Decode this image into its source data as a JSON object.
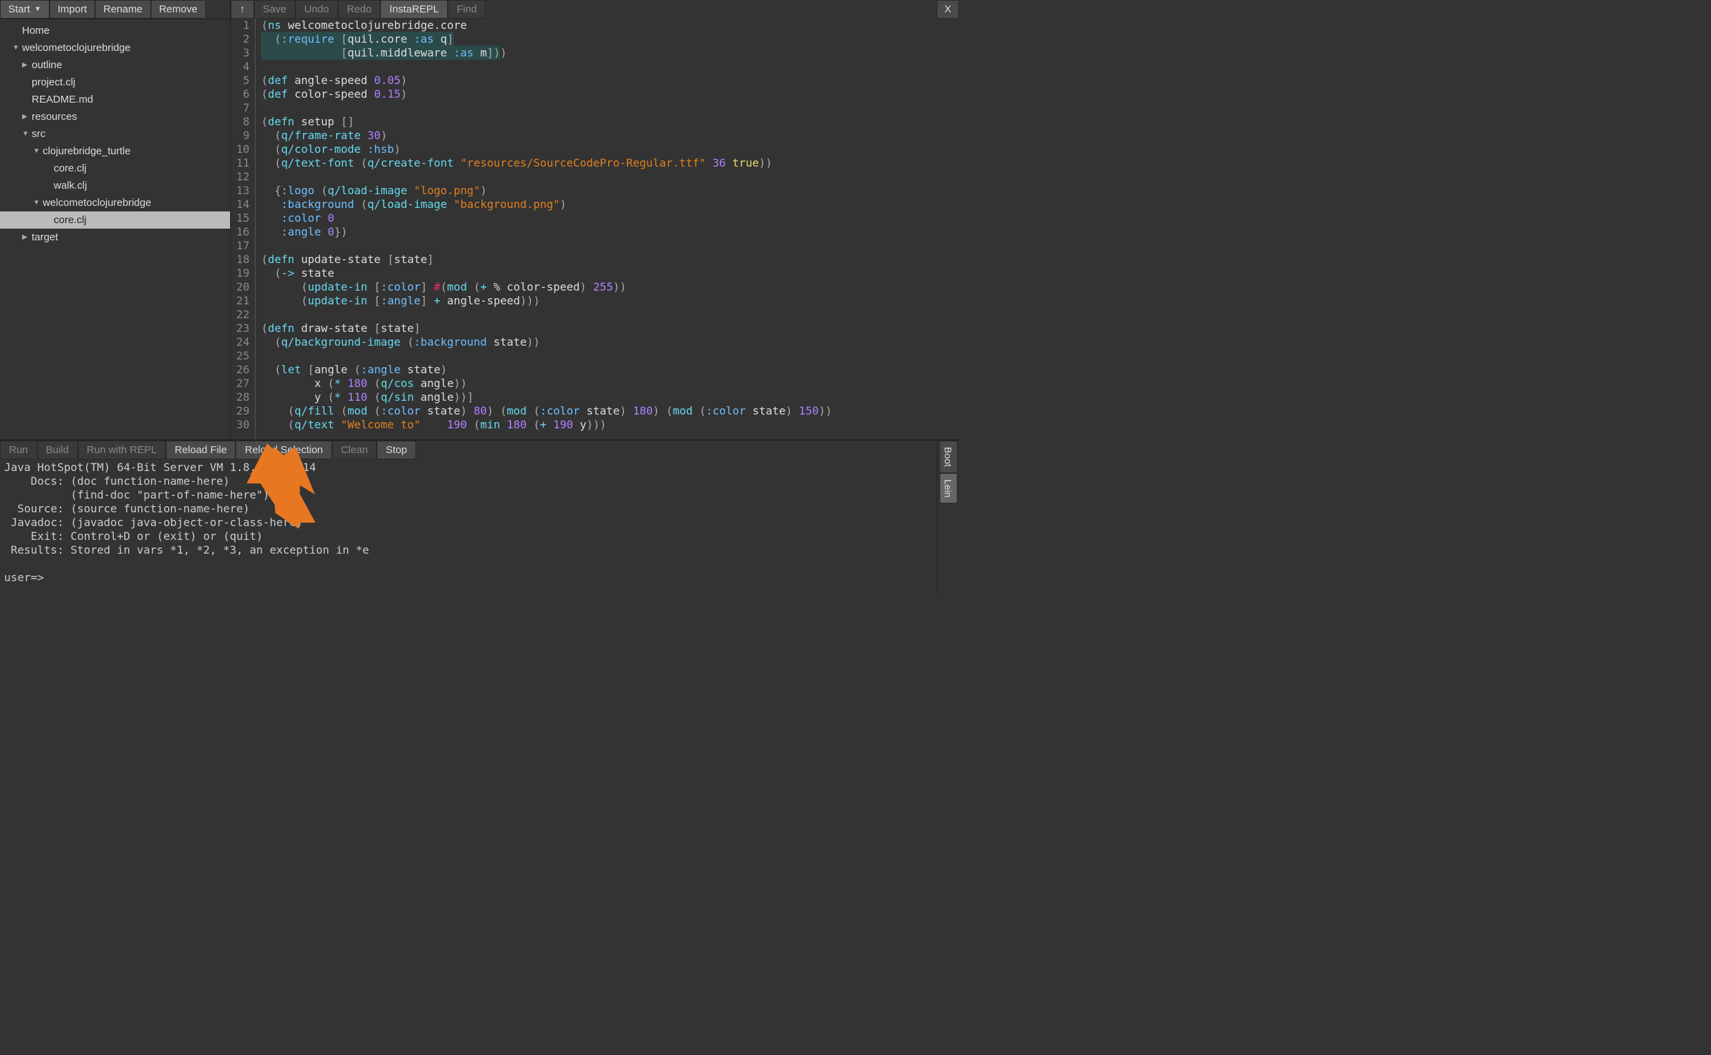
{
  "sidebar": {
    "buttons": {
      "start": "Start",
      "import": "Import",
      "rename": "Rename",
      "remove": "Remove"
    },
    "items": [
      {
        "label": "Home",
        "indent": 1,
        "tri": ""
      },
      {
        "label": "welcometoclojurebridge",
        "indent": 1,
        "tri": "▼"
      },
      {
        "label": "outline",
        "indent": 2,
        "tri": "▶"
      },
      {
        "label": "project.clj",
        "indent": 2,
        "tri": ""
      },
      {
        "label": "README.md",
        "indent": 2,
        "tri": ""
      },
      {
        "label": "resources",
        "indent": 2,
        "tri": "▶"
      },
      {
        "label": "src",
        "indent": 2,
        "tri": "▼"
      },
      {
        "label": "clojurebridge_turtle",
        "indent": 3,
        "tri": "▼"
      },
      {
        "label": "core.clj",
        "indent": 4,
        "tri": ""
      },
      {
        "label": "walk.clj",
        "indent": 4,
        "tri": ""
      },
      {
        "label": "welcometoclojurebridge",
        "indent": 3,
        "tri": "▼"
      },
      {
        "label": "core.clj",
        "indent": 4,
        "tri": "",
        "selected": true
      },
      {
        "label": "target",
        "indent": 2,
        "tri": "▶"
      }
    ]
  },
  "editor": {
    "buttons": {
      "up": "↑",
      "save": "Save",
      "undo": "Undo",
      "redo": "Redo",
      "instarepl": "InstaREPL",
      "find": "Find",
      "close": "X"
    }
  },
  "code_lines": [
    [
      [
        "p",
        "("
      ],
      [
        "fn",
        "ns"
      ],
      [
        "s",
        " "
      ],
      [
        "ns",
        "welcometoclojurebridge.core"
      ]
    ],
    [
      [
        "sel",
        "  "
      ],
      [
        "p",
        "(",
        true
      ],
      [
        "key",
        ":require",
        true
      ],
      [
        "s",
        " ",
        true
      ],
      [
        "p",
        "[",
        true
      ],
      [
        "ns",
        "quil.core",
        true
      ],
      [
        "s",
        " ",
        true
      ],
      [
        "key",
        ":as",
        true
      ],
      [
        "s",
        " ",
        true
      ],
      [
        "sym",
        "q",
        true
      ],
      [
        "p",
        "]",
        true
      ]
    ],
    [
      [
        "sel",
        "            "
      ],
      [
        "p",
        "[",
        true
      ],
      [
        "ns",
        "quil.middleware",
        true
      ],
      [
        "s",
        " ",
        true
      ],
      [
        "key",
        ":as",
        true
      ],
      [
        "s",
        " ",
        true
      ],
      [
        "sym",
        "m",
        true
      ],
      [
        "p",
        "]",
        true
      ],
      [
        "p",
        ")",
        true
      ],
      [
        "p",
        ")"
      ]
    ],
    [],
    [
      [
        "p",
        "("
      ],
      [
        "fn",
        "def"
      ],
      [
        "s",
        " "
      ],
      [
        "sym",
        "angle-speed"
      ],
      [
        "s",
        " "
      ],
      [
        "num",
        "0.05"
      ],
      [
        "p",
        ")"
      ]
    ],
    [
      [
        "p",
        "("
      ],
      [
        "fn",
        "def"
      ],
      [
        "s",
        " "
      ],
      [
        "sym",
        "color-speed"
      ],
      [
        "s",
        " "
      ],
      [
        "num",
        "0.15"
      ],
      [
        "p",
        ")"
      ]
    ],
    [],
    [
      [
        "p",
        "("
      ],
      [
        "fn",
        "defn"
      ],
      [
        "s",
        " "
      ],
      [
        "sym",
        "setup"
      ],
      [
        "s",
        " "
      ],
      [
        "p",
        "[]"
      ]
    ],
    [
      [
        "s",
        "  "
      ],
      [
        "p",
        "("
      ],
      [
        "fn",
        "q/frame-rate"
      ],
      [
        "s",
        " "
      ],
      [
        "num",
        "30"
      ],
      [
        "p",
        ")"
      ]
    ],
    [
      [
        "s",
        "  "
      ],
      [
        "p",
        "("
      ],
      [
        "fn",
        "q/color-mode"
      ],
      [
        "s",
        " "
      ],
      [
        "key",
        ":hsb"
      ],
      [
        "p",
        ")"
      ]
    ],
    [
      [
        "s",
        "  "
      ],
      [
        "p",
        "("
      ],
      [
        "fn",
        "q/text-font"
      ],
      [
        "s",
        " "
      ],
      [
        "p",
        "("
      ],
      [
        "fn",
        "q/create-font"
      ],
      [
        "s",
        " "
      ],
      [
        "str",
        "\"resources/SourceCodePro-Regular.ttf\""
      ],
      [
        "s",
        " "
      ],
      [
        "num",
        "36"
      ],
      [
        "s",
        " "
      ],
      [
        "kw",
        "true"
      ],
      [
        "p",
        "))"
      ]
    ],
    [],
    [
      [
        "s",
        "  "
      ],
      [
        "p",
        "{"
      ],
      [
        "key",
        ":logo"
      ],
      [
        "s",
        " "
      ],
      [
        "p",
        "("
      ],
      [
        "fn",
        "q/load-image"
      ],
      [
        "s",
        " "
      ],
      [
        "str",
        "\"logo.png\""
      ],
      [
        "p",
        ")"
      ]
    ],
    [
      [
        "s",
        "   "
      ],
      [
        "key",
        ":background"
      ],
      [
        "s",
        " "
      ],
      [
        "p",
        "("
      ],
      [
        "fn",
        "q/load-image"
      ],
      [
        "s",
        " "
      ],
      [
        "str",
        "\"background.png\""
      ],
      [
        "p",
        ")"
      ]
    ],
    [
      [
        "s",
        "   "
      ],
      [
        "key",
        ":color"
      ],
      [
        "s",
        " "
      ],
      [
        "num",
        "0"
      ]
    ],
    [
      [
        "s",
        "   "
      ],
      [
        "key",
        ":angle"
      ],
      [
        "s",
        " "
      ],
      [
        "num",
        "0"
      ],
      [
        "p",
        "})"
      ]
    ],
    [],
    [
      [
        "p",
        "("
      ],
      [
        "fn",
        "defn"
      ],
      [
        "s",
        " "
      ],
      [
        "sym",
        "update-state"
      ],
      [
        "s",
        " "
      ],
      [
        "p",
        "["
      ],
      [
        "sym",
        "state"
      ],
      [
        "p",
        "]"
      ]
    ],
    [
      [
        "s",
        "  "
      ],
      [
        "p",
        "("
      ],
      [
        "fn",
        "->"
      ],
      [
        "s",
        " "
      ],
      [
        "sym",
        "state"
      ]
    ],
    [
      [
        "s",
        "      "
      ],
      [
        "p",
        "("
      ],
      [
        "fn",
        "update-in"
      ],
      [
        "s",
        " "
      ],
      [
        "p",
        "["
      ],
      [
        "key",
        ":color"
      ],
      [
        "p",
        "]"
      ],
      [
        "s",
        " "
      ],
      [
        "op",
        "#"
      ],
      [
        "p",
        "("
      ],
      [
        "fn",
        "mod"
      ],
      [
        "s",
        " "
      ],
      [
        "p",
        "("
      ],
      [
        "fn",
        "+"
      ],
      [
        "s",
        " "
      ],
      [
        "sym",
        "%"
      ],
      [
        "s",
        " "
      ],
      [
        "sym",
        "color-speed"
      ],
      [
        "p",
        ")"
      ],
      [
        "s",
        " "
      ],
      [
        "num",
        "255"
      ],
      [
        "p",
        "))"
      ]
    ],
    [
      [
        "s",
        "      "
      ],
      [
        "p",
        "("
      ],
      [
        "fn",
        "update-in"
      ],
      [
        "s",
        " "
      ],
      [
        "p",
        "["
      ],
      [
        "key",
        ":angle"
      ],
      [
        "p",
        "]"
      ],
      [
        "s",
        " "
      ],
      [
        "fn",
        "+"
      ],
      [
        "s",
        " "
      ],
      [
        "sym",
        "angle-speed"
      ],
      [
        "p",
        ")))"
      ]
    ],
    [],
    [
      [
        "p",
        "("
      ],
      [
        "fn",
        "defn"
      ],
      [
        "s",
        " "
      ],
      [
        "sym",
        "draw-state"
      ],
      [
        "s",
        " "
      ],
      [
        "p",
        "["
      ],
      [
        "sym",
        "state"
      ],
      [
        "p",
        "]"
      ]
    ],
    [
      [
        "s",
        "  "
      ],
      [
        "p",
        "("
      ],
      [
        "fn",
        "q/background-image"
      ],
      [
        "s",
        " "
      ],
      [
        "p",
        "("
      ],
      [
        "key",
        ":background"
      ],
      [
        "s",
        " "
      ],
      [
        "sym",
        "state"
      ],
      [
        "p",
        "))"
      ]
    ],
    [],
    [
      [
        "s",
        "  "
      ],
      [
        "p",
        "("
      ],
      [
        "fn",
        "let"
      ],
      [
        "s",
        " "
      ],
      [
        "p",
        "["
      ],
      [
        "sym",
        "angle"
      ],
      [
        "s",
        " "
      ],
      [
        "p",
        "("
      ],
      [
        "key",
        ":angle"
      ],
      [
        "s",
        " "
      ],
      [
        "sym",
        "state"
      ],
      [
        "p",
        ")"
      ]
    ],
    [
      [
        "s",
        "        "
      ],
      [
        "sym",
        "x"
      ],
      [
        "s",
        " "
      ],
      [
        "p",
        "("
      ],
      [
        "fn",
        "*"
      ],
      [
        "s",
        " "
      ],
      [
        "num",
        "180"
      ],
      [
        "s",
        " "
      ],
      [
        "p",
        "("
      ],
      [
        "fn",
        "q/cos"
      ],
      [
        "s",
        " "
      ],
      [
        "sym",
        "angle"
      ],
      [
        "p",
        "))"
      ]
    ],
    [
      [
        "s",
        "        "
      ],
      [
        "sym",
        "y"
      ],
      [
        "s",
        " "
      ],
      [
        "p",
        "("
      ],
      [
        "fn",
        "*"
      ],
      [
        "s",
        " "
      ],
      [
        "num",
        "110"
      ],
      [
        "s",
        " "
      ],
      [
        "p",
        "("
      ],
      [
        "fn",
        "q/sin"
      ],
      [
        "s",
        " "
      ],
      [
        "sym",
        "angle"
      ],
      [
        "p",
        "))]"
      ]
    ],
    [
      [
        "s",
        "    "
      ],
      [
        "p",
        "("
      ],
      [
        "fn",
        "q/fill"
      ],
      [
        "s",
        " "
      ],
      [
        "p",
        "("
      ],
      [
        "fn",
        "mod"
      ],
      [
        "s",
        " "
      ],
      [
        "p",
        "("
      ],
      [
        "key",
        ":color"
      ],
      [
        "s",
        " "
      ],
      [
        "sym",
        "state"
      ],
      [
        "p",
        ")"
      ],
      [
        "s",
        " "
      ],
      [
        "num",
        "80"
      ],
      [
        "p",
        ")"
      ],
      [
        "s",
        " "
      ],
      [
        "p",
        "("
      ],
      [
        "fn",
        "mod"
      ],
      [
        "s",
        " "
      ],
      [
        "p",
        "("
      ],
      [
        "key",
        ":color"
      ],
      [
        "s",
        " "
      ],
      [
        "sym",
        "state"
      ],
      [
        "p",
        ")"
      ],
      [
        "s",
        " "
      ],
      [
        "num",
        "180"
      ],
      [
        "p",
        ")"
      ],
      [
        "s",
        " "
      ],
      [
        "p",
        "("
      ],
      [
        "fn",
        "mod"
      ],
      [
        "s",
        " "
      ],
      [
        "p",
        "("
      ],
      [
        "key",
        ":color"
      ],
      [
        "s",
        " "
      ],
      [
        "sym",
        "state"
      ],
      [
        "p",
        ")"
      ],
      [
        "s",
        " "
      ],
      [
        "num",
        "150"
      ],
      [
        "p",
        "))"
      ]
    ],
    [
      [
        "s",
        "    "
      ],
      [
        "p",
        "("
      ],
      [
        "fn",
        "q/text"
      ],
      [
        "s",
        " "
      ],
      [
        "str",
        "\"Welcome to\""
      ],
      [
        "s",
        "    "
      ],
      [
        "num",
        "190"
      ],
      [
        "s",
        " "
      ],
      [
        "p",
        "("
      ],
      [
        "fn",
        "min"
      ],
      [
        "s",
        " "
      ],
      [
        "num",
        "180"
      ],
      [
        "s",
        " "
      ],
      [
        "p",
        "("
      ],
      [
        "fn",
        "+"
      ],
      [
        "s",
        " "
      ],
      [
        "num",
        "190"
      ],
      [
        "s",
        " "
      ],
      [
        "sym",
        "y"
      ],
      [
        "p",
        ")))"
      ]
    ]
  ],
  "repl": {
    "buttons": {
      "run": "Run",
      "build": "Build",
      "runrepl": "Run with REPL",
      "reload": "Reload File",
      "reloadsel": "Reload Selection",
      "clean": "Clean",
      "stop": "Stop"
    },
    "tabs": {
      "boot": "Boot",
      "lein": "Lein"
    },
    "lines": [
      "Java HotSpot(TM) 64-Bit Server VM 1.8.0_102-b14",
      "    Docs: (doc function-name-here)",
      "          (find-doc \"part-of-name-here\")",
      "  Source: (source function-name-here)",
      " Javadoc: (javadoc java-object-or-class-here)",
      "    Exit: Control+D or (exit) or (quit)",
      " Results: Stored in vars *1, *2, *3, an exception in *e",
      "",
      "user=>"
    ]
  }
}
